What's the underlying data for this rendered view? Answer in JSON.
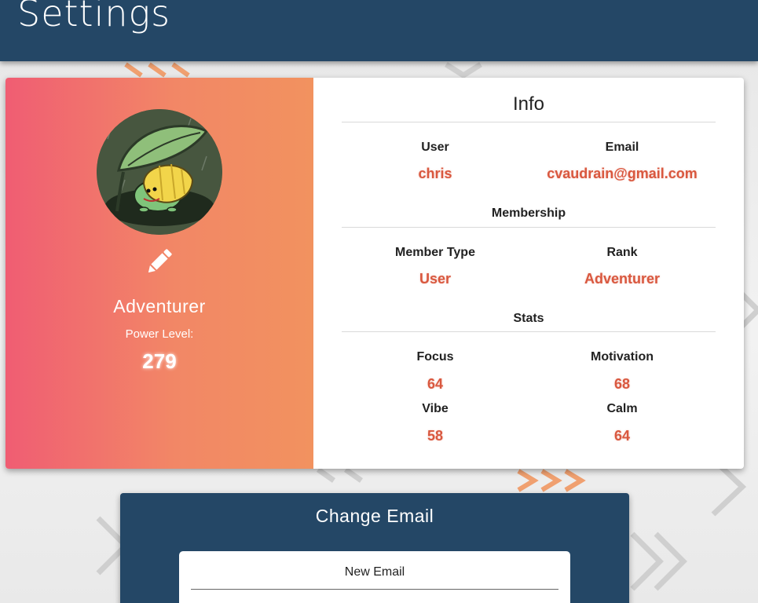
{
  "header": {
    "title": "Settings"
  },
  "profile": {
    "rank_name": "Adventurer",
    "power_label": "Power Level:",
    "power_value": "279",
    "avatar_icon": "frog-with-leaf-avatar",
    "edit_icon": "pencil-icon"
  },
  "info": {
    "title": "Info",
    "user_label": "User",
    "user_value": "chris",
    "email_label": "Email",
    "email_value": "cvaudrain@gmail.com",
    "membership_title": "Membership",
    "member_type_label": "Member Type",
    "member_type_value": "User",
    "rank_label": "Rank",
    "rank_value": "Adventurer",
    "stats_title": "Stats",
    "stats": [
      {
        "label": "Focus",
        "value": "64"
      },
      {
        "label": "Motivation",
        "value": "68"
      },
      {
        "label": "Vibe",
        "value": "58"
      },
      {
        "label": "Calm",
        "value": "64"
      }
    ]
  },
  "change_email": {
    "title": "Change Email",
    "new_email_label": "New Email",
    "new_email_value": ""
  },
  "colors": {
    "header_bg": "#244766",
    "accent_value": "#d9583f",
    "gradient_start": "#f05d73",
    "gradient_end": "#f2925f"
  }
}
